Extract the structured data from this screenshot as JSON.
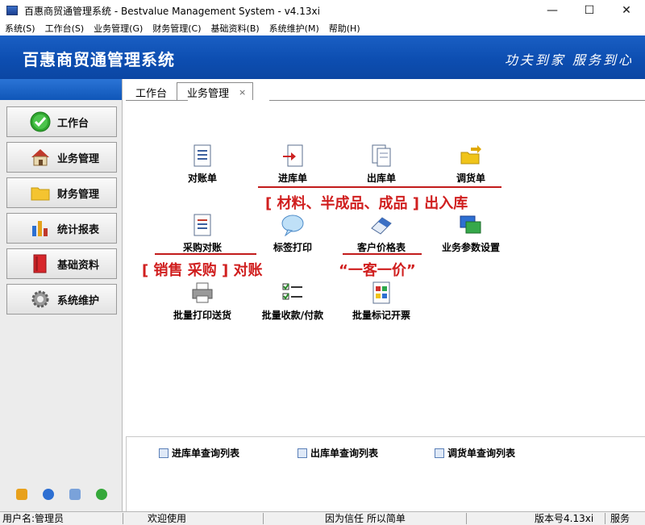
{
  "window": {
    "title": "百惠商贸通管理系统 - Bestvalue Management System - v4.13xi",
    "minimize_glyph": "—",
    "maximize_glyph": "☐",
    "close_glyph": "✕"
  },
  "menu": [
    "系统(S)",
    "工作台(S)",
    "业务管理(G)",
    "财务管理(C)",
    "基础资料(B)",
    "系统维护(M)",
    "帮助(H)"
  ],
  "banner": {
    "app_name": "百惠商贸通管理系统",
    "slogan": "功夫到家 服务到心",
    "color": "#0d4eb1"
  },
  "sidebar": {
    "items": [
      {
        "label": "工作台",
        "icon": "check-circle-icon"
      },
      {
        "label": "业务管理",
        "icon": "house-icon"
      },
      {
        "label": "财务管理",
        "icon": "folder-icon"
      },
      {
        "label": "统计报表",
        "icon": "bar-chart-icon"
      },
      {
        "label": "基础资料",
        "icon": "book-icon"
      },
      {
        "label": "系统维护",
        "icon": "gear-icon"
      }
    ],
    "bottom_icons": [
      "key-icon",
      "clock-icon",
      "search-window-icon",
      "back-arrow-icon"
    ]
  },
  "tabs": [
    {
      "label": "工作台",
      "active": false
    },
    {
      "label": "业务管理",
      "active": true,
      "close": "×"
    }
  ],
  "functions": {
    "reconcile": "对账单",
    "stock_in": "进库单",
    "stock_out": "出库单",
    "transfer": "调货单",
    "purchase_reconcile": "采购对账",
    "label_print": "标签打印",
    "customer_price": "客户价格表",
    "business_params": "业务参数设置",
    "batch_print": "批量打印送货",
    "batch_payment": "批量收款/付款",
    "batch_invoice": "批量标记开票"
  },
  "annotations": {
    "stock_note": "[ 材料、半成品、成品 ] 出入库",
    "reconcile_note": "[ 销售 采购 ] 对账",
    "price_note": "“一客一价”",
    "color": "#d01e1e"
  },
  "query_links": [
    "进库单查询列表",
    "出库单查询列表",
    "调货单查询列表"
  ],
  "status": {
    "user": "用户名:管理员",
    "welcome": "欢迎使用",
    "motto": "因为信任 所以简单",
    "version": "版本号4.13xi",
    "service": "服务"
  }
}
